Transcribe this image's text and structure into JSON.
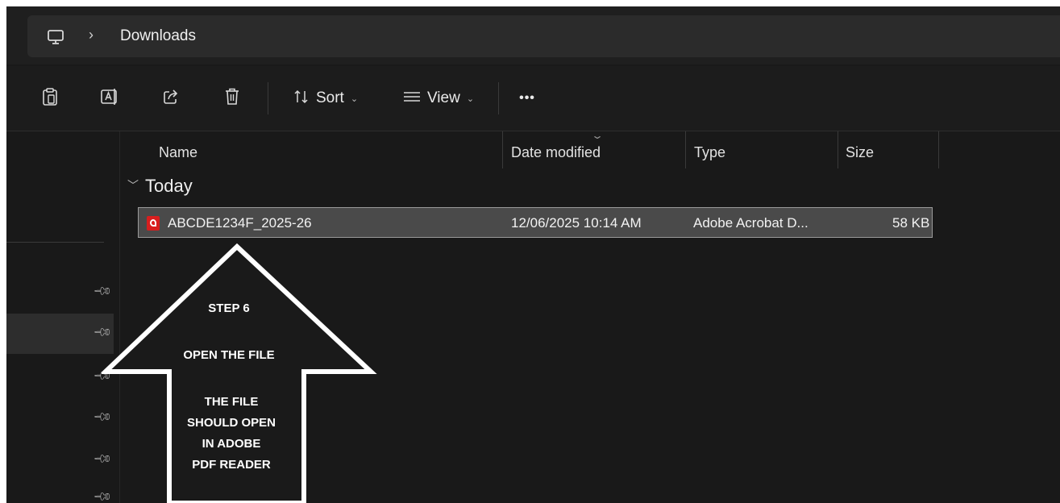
{
  "address_bar": {
    "icon": "monitor-icon",
    "separator": "›",
    "location": "Downloads"
  },
  "toolbar": {
    "buttons": [
      {
        "icon": "paste-icon"
      },
      {
        "icon": "rename-icon"
      },
      {
        "icon": "share-icon"
      },
      {
        "icon": "delete-icon"
      }
    ],
    "sort_label": "Sort",
    "view_label": "View",
    "more_label": "•••"
  },
  "columns": {
    "name": "Name",
    "date_modified": "Date modified",
    "type": "Type",
    "size": "Size"
  },
  "group": {
    "label": "Today"
  },
  "files": [
    {
      "name": "ABCDE1234F_2025-26",
      "date_modified": "12/06/2025 10:14 AM",
      "type": "Adobe Acrobat D...",
      "size": "58 KB",
      "icon": "pdf-icon"
    }
  ],
  "annotation": {
    "step": "STEP 6",
    "instruction": "OPEN THE FILE",
    "line1": "THE FILE",
    "line2": "SHOULD OPEN",
    "line3": "IN ADOBE",
    "line4": "PDF READER",
    "arrow_color": "#ffffff"
  },
  "colors": {
    "background": "#191919",
    "selected_row": "#4a4a4a",
    "pdf_red": "#d81e1e"
  }
}
